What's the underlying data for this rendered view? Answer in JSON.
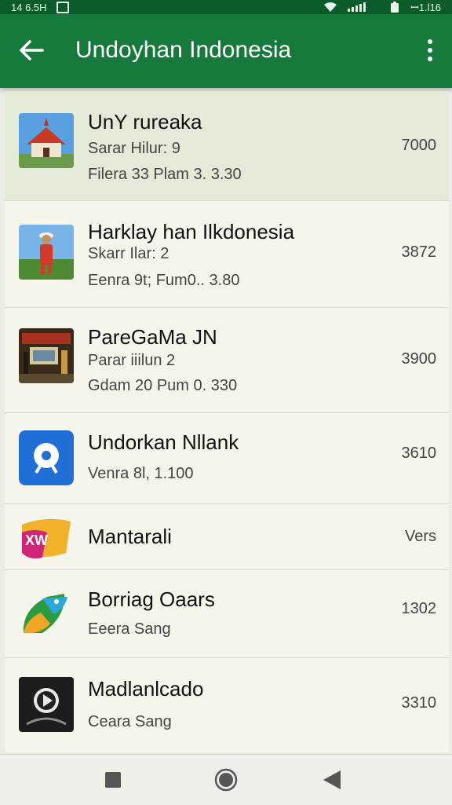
{
  "status": {
    "time": "14 6.5H",
    "right_text": "ꟷ1.l16"
  },
  "appbar": {
    "title": "Undoyhan Indonesia"
  },
  "rows": [
    {
      "title": "UnY rureaka",
      "line1": "Sarar Hilur: 9",
      "line2": "Filera 33 Plam 3. 3.30",
      "value": "7000"
    },
    {
      "title": "Harklay han Ilkdonesia",
      "line1": "Skarr Ilar: 2",
      "line2": "Eenra 9t; Fum0.. 3.80",
      "value": "3872"
    },
    {
      "title": "PareGaMa JN",
      "line1": "Parar iiilun 2",
      "line2": "Gdam 20 Pum 0. 330",
      "value": "3900"
    },
    {
      "title": "Undorkan Nllank",
      "line1": "Venra 8l, 1.100",
      "value": "3610"
    },
    {
      "title": "Mantarali",
      "value": "Vers"
    },
    {
      "title": "Borriag Oaars",
      "line1": "Eeera Sang",
      "value": "1302"
    },
    {
      "title": "Madlanlcado",
      "line1": "Ceara Sang",
      "value": "3310"
    }
  ],
  "colors": {
    "appbar": "#157a3c",
    "statusbar": "#0b5b2c",
    "list_bg": "#f6f5ec",
    "highlight": "#e3ead8"
  }
}
